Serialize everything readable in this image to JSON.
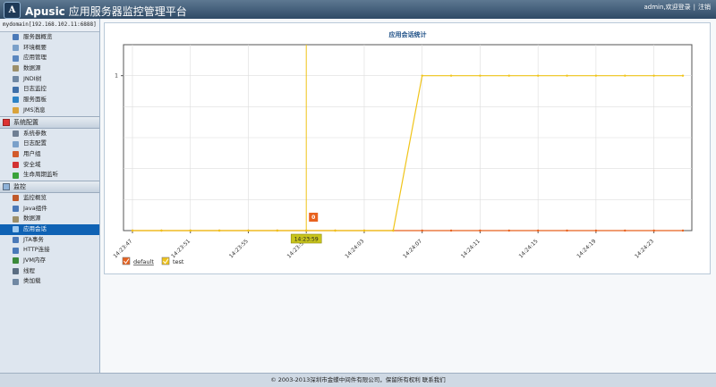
{
  "header": {
    "brand": "Apusic",
    "title": "应用服务器监控管理平台",
    "logo_text": "A",
    "user": "admin",
    "welcome": "欢迎登录",
    "logout": "注销"
  },
  "sidebar": {
    "domain": "mydomain[192.168.102.11:6888]",
    "top_items": [
      {
        "label": "服务器概览",
        "icon": "server-icon",
        "color": "#4a79b8"
      },
      {
        "label": "环境概要",
        "icon": "doc-icon",
        "color": "#7aa0c9"
      },
      {
        "label": "应用管理",
        "icon": "app-icon",
        "color": "#5b87bf"
      },
      {
        "label": "数据源",
        "icon": "database-icon",
        "color": "#9c8f6a"
      },
      {
        "label": "JNDI树",
        "icon": "tree-icon",
        "color": "#7088a3"
      },
      {
        "label": "日志监控",
        "icon": "monitor-icon",
        "color": "#3f6fa8"
      },
      {
        "label": "服务面板",
        "icon": "panel-icon",
        "color": "#2c83c6"
      },
      {
        "label": "JMS消息",
        "icon": "message-icon",
        "color": "#d9a33b"
      }
    ],
    "config_section": "系统配置",
    "config_items": [
      {
        "label": "系统参数",
        "icon": "settings-icon",
        "color": "#6f7f93"
      },
      {
        "label": "日志配置",
        "icon": "log-icon",
        "color": "#7aa0c9"
      },
      {
        "label": "用户组",
        "icon": "users-icon",
        "color": "#d25b2c"
      },
      {
        "label": "安全域",
        "icon": "security-icon",
        "color": "#d23232"
      },
      {
        "label": "生命周期监听",
        "icon": "lifecycle-icon",
        "color": "#3aa23a"
      }
    ],
    "monitor_section": "监控",
    "monitor_items": [
      {
        "label": "监控概览",
        "icon": "chart-icon",
        "color": "#c0592a"
      },
      {
        "label": "Java组件",
        "icon": "java-icon",
        "color": "#4a79b8"
      },
      {
        "label": "数据源",
        "icon": "database-icon",
        "color": "#9c8f6a"
      },
      {
        "label": "应用会话",
        "icon": "session-icon",
        "color": "#9cc9f0",
        "active": true
      },
      {
        "label": "JTA事务",
        "icon": "transaction-icon",
        "color": "#4a79b8"
      },
      {
        "label": "HTTP连接",
        "icon": "http-icon",
        "color": "#4a79b8"
      },
      {
        "label": "JVM内存",
        "icon": "memory-icon",
        "color": "#3b8a3b"
      },
      {
        "label": "线程",
        "icon": "thread-icon",
        "color": "#5a6d82"
      },
      {
        "label": "类加载",
        "icon": "classload-icon",
        "color": "#7088a3"
      }
    ]
  },
  "chart_data": {
    "type": "line",
    "title": "应用会话统计",
    "categories": [
      "14:23:47",
      "14:23:49",
      "14:23:51",
      "14:23:53",
      "14:23:55",
      "14:23:57",
      "14:23:59",
      "14:24:01",
      "14:24:03",
      "14:24:05",
      "14:24:07",
      "14:24:09",
      "14:24:11",
      "14:24:13",
      "14:24:15",
      "14:24:17",
      "14:24:19",
      "14:24:21",
      "14:24:23",
      "14:24:25"
    ],
    "tick_labels": [
      "14:23:47",
      "14:23:51",
      "14:23:55",
      "14:23:59",
      "14:24:03",
      "14:24:07",
      "14:24:11",
      "14:24:15",
      "14:24:19",
      "14:24:23"
    ],
    "ylim": [
      0,
      1.2
    ],
    "yticks": [
      {
        "value": 1,
        "label": "1"
      }
    ],
    "series": [
      {
        "name": "default",
        "color": "#e8621f",
        "values": [
          0,
          0,
          0,
          0,
          0,
          0,
          0,
          0,
          0,
          0,
          0,
          0,
          0,
          0,
          0,
          0,
          0,
          0,
          0,
          0
        ]
      },
      {
        "name": "test",
        "color": "#f0c419",
        "values": [
          0,
          0,
          0,
          0,
          0,
          0,
          0,
          0,
          0,
          0,
          1,
          1,
          1,
          1,
          1,
          1,
          1,
          1,
          1,
          1
        ]
      }
    ],
    "crosshair": {
      "x": "14:23:59",
      "point_value": "0",
      "x_label": "14:23:59"
    },
    "grid": true,
    "legend": "bottom-left"
  },
  "footer": {
    "text": "© 2003-2013深圳市金蝶中间件有限公司，保留所有权利  联系我们"
  }
}
